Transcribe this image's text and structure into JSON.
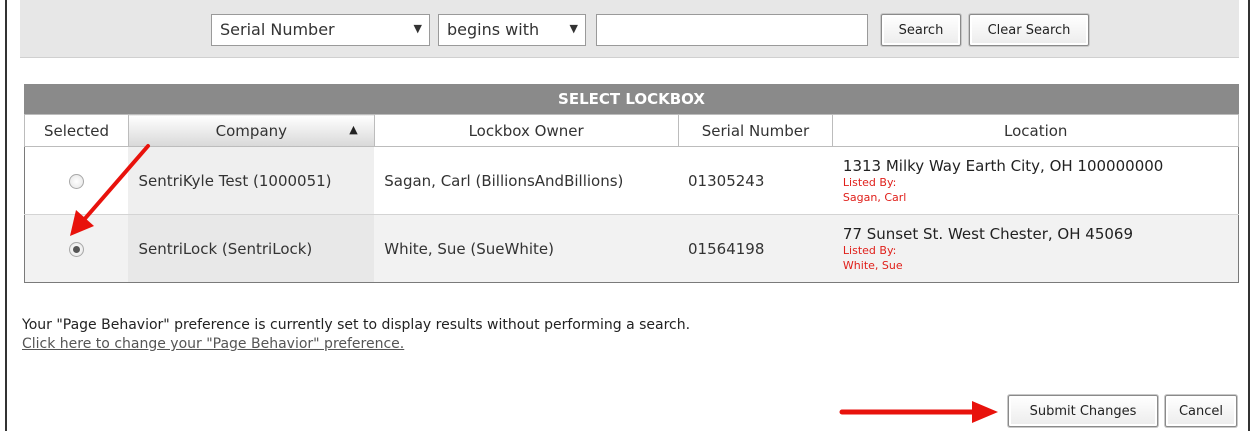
{
  "search": {
    "field_selected": "Serial Number",
    "operator_selected": "begins with",
    "query_value": "",
    "search_label": "Search",
    "clear_label": "Clear Search"
  },
  "panel": {
    "title": "SELECT LOCKBOX"
  },
  "table": {
    "columns": [
      "Selected",
      "Company",
      "Lockbox Owner",
      "Serial Number",
      "Location"
    ],
    "sorted_column": "Company",
    "rows": [
      {
        "selected": false,
        "company": "SentriKyle Test (1000051)",
        "owner": "Sagan, Carl (BillionsAndBillions)",
        "serial": "01305243",
        "address": "1313 Milky Way Earth City, OH 100000000",
        "listed_by_label": "Listed By:",
        "listed_by": "Sagan, Carl"
      },
      {
        "selected": true,
        "company": "SentriLock (SentriLock)",
        "owner": "White, Sue (SueWhite)",
        "serial": "01564198",
        "address": "77 Sunset St. West Chester, OH 45069",
        "listed_by_label": "Listed By:",
        "listed_by": "White, Sue"
      }
    ]
  },
  "notice": {
    "text": "Your \"Page Behavior\" preference is currently set to display results without performing a search.",
    "link": "Click here to change your \"Page Behavior\" preference."
  },
  "actions": {
    "submit_label": "Submit Changes",
    "cancel_label": "Cancel"
  },
  "colors": {
    "annotation_arrow": "#e8120c",
    "listed_by_text": "#e0201b",
    "panel_header": "#8a8a8a"
  }
}
